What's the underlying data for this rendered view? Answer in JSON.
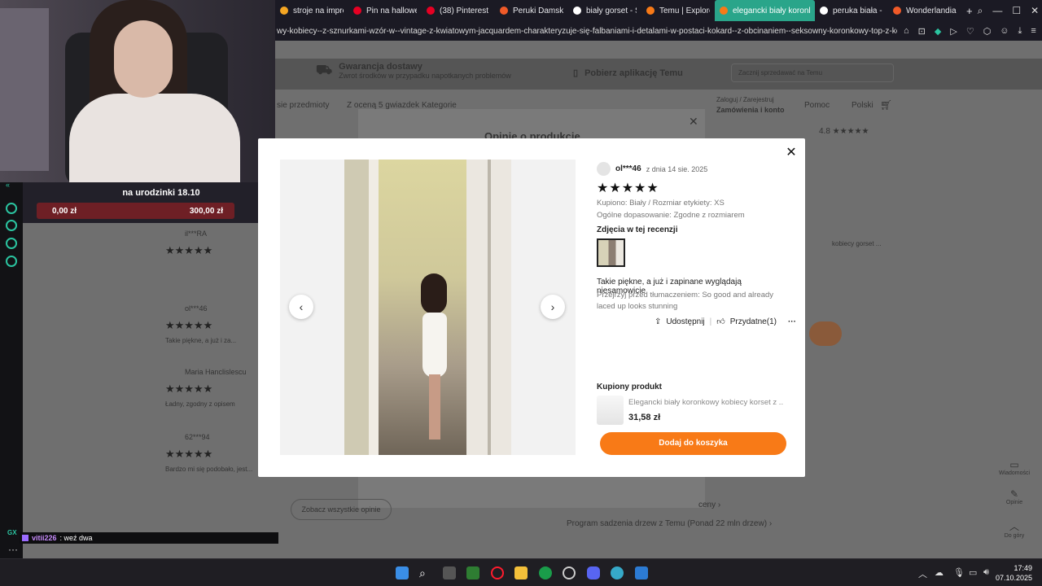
{
  "browser": {
    "tabs": [
      {
        "label": "stroje na impre",
        "color": "#f5a623"
      },
      {
        "label": "Pin na hallowe",
        "color": "#e60023"
      },
      {
        "label": "(38) Pinterest",
        "color": "#e60023"
      },
      {
        "label": "Peruki Damskie",
        "color": "#f05a28"
      },
      {
        "label": "biały gorset - S",
        "color": "#ffffff"
      },
      {
        "label": "Temu | Explore",
        "color": "#f87a17"
      },
      {
        "label": "elegancki biały koronkow",
        "color": "#f87a17",
        "active": true
      },
      {
        "label": "peruka biała - S",
        "color": "#ffffff"
      },
      {
        "label": "Wonderlandia p",
        "color": "#f05a28"
      }
    ],
    "new_tab": "+",
    "url": "wy-kobiecy--z-sznurkami-wzór-w--vintage-z-kwiatowym-jacquardem-charakteryzuje-się-falbaniami-i-detalami-w-postaci-kokard--z-obcinaniem--seksowny-koronkowy-top-z-kontrolą"
  },
  "site": {
    "guarantee_title": "Gwarancja dostawy",
    "guarantee_sub": "Zwrot środków w przypadku napotkanych problemów",
    "app_label": "Pobierz aplikację Temu",
    "sell_label": "Zacznij sprzedawać na Temu",
    "nav_items": [
      "sie przedmioty",
      "Z oceną 5 gwiazdek",
      "Kategorie"
    ],
    "account_top": "Zaloguj / Zarejestruj",
    "account_bottom": "Zamówienia i konto",
    "help": "Pomoc",
    "lang": "Polski",
    "behind_modal_title": "Opinie o produkcie",
    "rating_summary": "4.8 ★★★★★",
    "see_all": "Zobacz wszystkie opinie",
    "program": "Program sadzenia drzew z Temu (Ponad 22 mln drzew) ›",
    "behind_snippet": "kobiecy gorset ...",
    "prices_link": "ceny ›"
  },
  "stream": {
    "donation_title": "na urodzinki 18.10",
    "donation_current": "0,00 zł",
    "donation_goal": "300,00 zł",
    "chat_user": "vitii226",
    "chat_message": ": weź dwa",
    "gx_label": "GX"
  },
  "behind_reviews": [
    {
      "user": "il***RA",
      "text": ""
    },
    {
      "user": "ol***46",
      "text": "Takie piękne, a już i za..."
    },
    {
      "user": "Maria Hanclislescu",
      "text": "Ładny, zgodny z opisem"
    },
    {
      "user": "62***94",
      "text": "Bardzo mi się podobało, jest..."
    }
  ],
  "review": {
    "user": "ol***46",
    "date": "z dnia 14 sie. 2025",
    "stars": "★★★★★",
    "purchased": "Kupiono: Biały / Rozmiar etykiety: XS",
    "fit": "Ogólne dopasowanie: Zgodne z rozmiarem",
    "photos_heading": "Zdjęcia w tej recenzji",
    "text": "Takie piękne, a już i zapinane wyglądają niesamowicie",
    "original": "Przejrzyj przed tłumaczeniem: So good and already laced up looks stunning",
    "share": "Udostępnij",
    "helpful": "Przydatne(1)",
    "more": "···",
    "close": "✕",
    "prev": "‹",
    "next": "›"
  },
  "product": {
    "heading": "Kupiony produkt",
    "name": "Elegancki biały koronkowy kobiecy korset z ...",
    "price": "31,58 zł",
    "cta": "Dodaj do koszyka"
  },
  "rail": {
    "messages": "Wiadomości",
    "reviews": "Opinie",
    "top": "Do góry"
  },
  "taskbar": {
    "time": "17:49",
    "date": "07.10.2025"
  }
}
